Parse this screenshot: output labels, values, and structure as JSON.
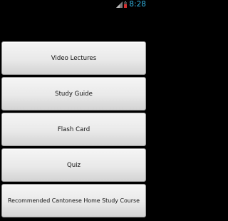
{
  "status_bar": {
    "time": "8:28",
    "icons": [
      "signal-icon",
      "battery-icon"
    ],
    "accent_color": "#33b5e5",
    "battery_color": "#d32f2f"
  },
  "menu": {
    "items": [
      {
        "label": "Video Lectures"
      },
      {
        "label": "Study Guide"
      },
      {
        "label": "Flash Card"
      },
      {
        "label": "Quiz"
      },
      {
        "label": "Recommended Cantonese Home Study Course"
      }
    ]
  }
}
